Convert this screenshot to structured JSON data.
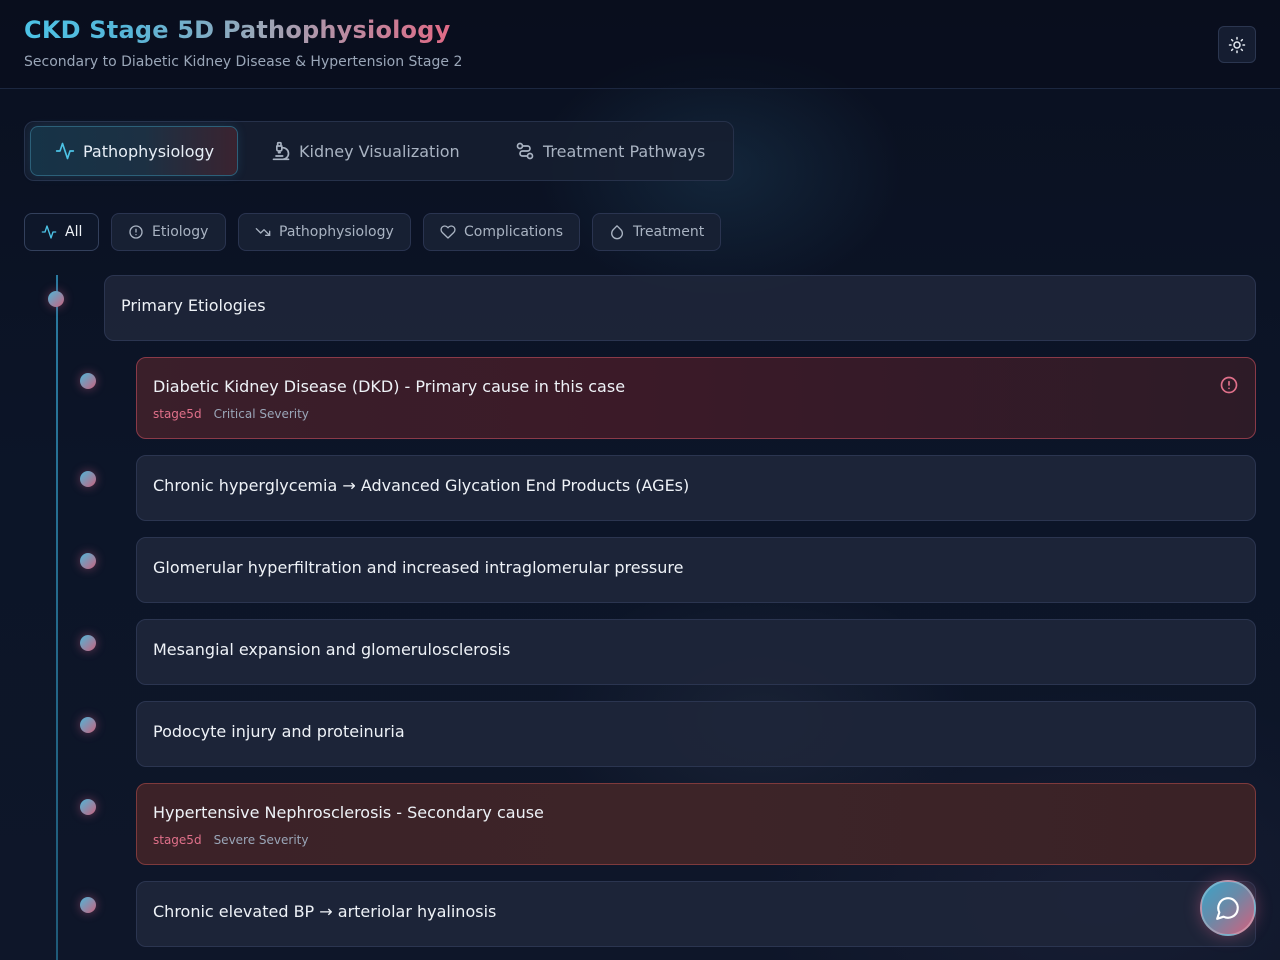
{
  "header": {
    "title": "CKD Stage 5D Pathophysiology",
    "subtitle": "Secondary to Diabetic Kidney Disease & Hypertension Stage 2",
    "theme_icon": "sun-icon"
  },
  "tabs": [
    {
      "label": "Pathophysiology",
      "icon": "activity-icon",
      "active": true
    },
    {
      "label": "Kidney Visualization",
      "icon": "microscope-icon",
      "active": false
    },
    {
      "label": "Treatment Pathways",
      "icon": "route-icon",
      "active": false
    }
  ],
  "filters": [
    {
      "label": "All",
      "icon": "activity-icon",
      "active": true
    },
    {
      "label": "Etiology",
      "icon": "alert-circle-icon",
      "active": false
    },
    {
      "label": "Pathophysiology",
      "icon": "trending-down-icon",
      "active": false
    },
    {
      "label": "Complications",
      "icon": "heart-icon",
      "active": false
    },
    {
      "label": "Treatment",
      "icon": "droplet-icon",
      "active": false
    }
  ],
  "timeline": [
    {
      "text": "Primary Etiologies"
    },
    {
      "text": "Diabetic Kidney Disease (DKD) - Primary cause in this case",
      "stage": "stage5d",
      "severity": "Critical Severity"
    },
    {
      "text": "Chronic hyperglycemia → Advanced Glycation End Products (AGEs)"
    },
    {
      "text": "Glomerular hyperfiltration and increased intraglomerular pressure"
    },
    {
      "text": "Mesangial expansion and glomerulosclerosis"
    },
    {
      "text": "Podocyte injury and proteinuria"
    },
    {
      "text": "Hypertensive Nephrosclerosis - Secondary cause",
      "stage": "stage5d",
      "severity": "Severe Severity"
    },
    {
      "text": "Chronic elevated BP → arteriolar hyalinosis"
    }
  ],
  "colors": {
    "accent_cyan": "#4cc3e6",
    "accent_pink": "#e06a86",
    "critical_border": "#8a3a48",
    "severe_border": "#7e3a3c"
  },
  "chat_icon": "message-circle-icon"
}
